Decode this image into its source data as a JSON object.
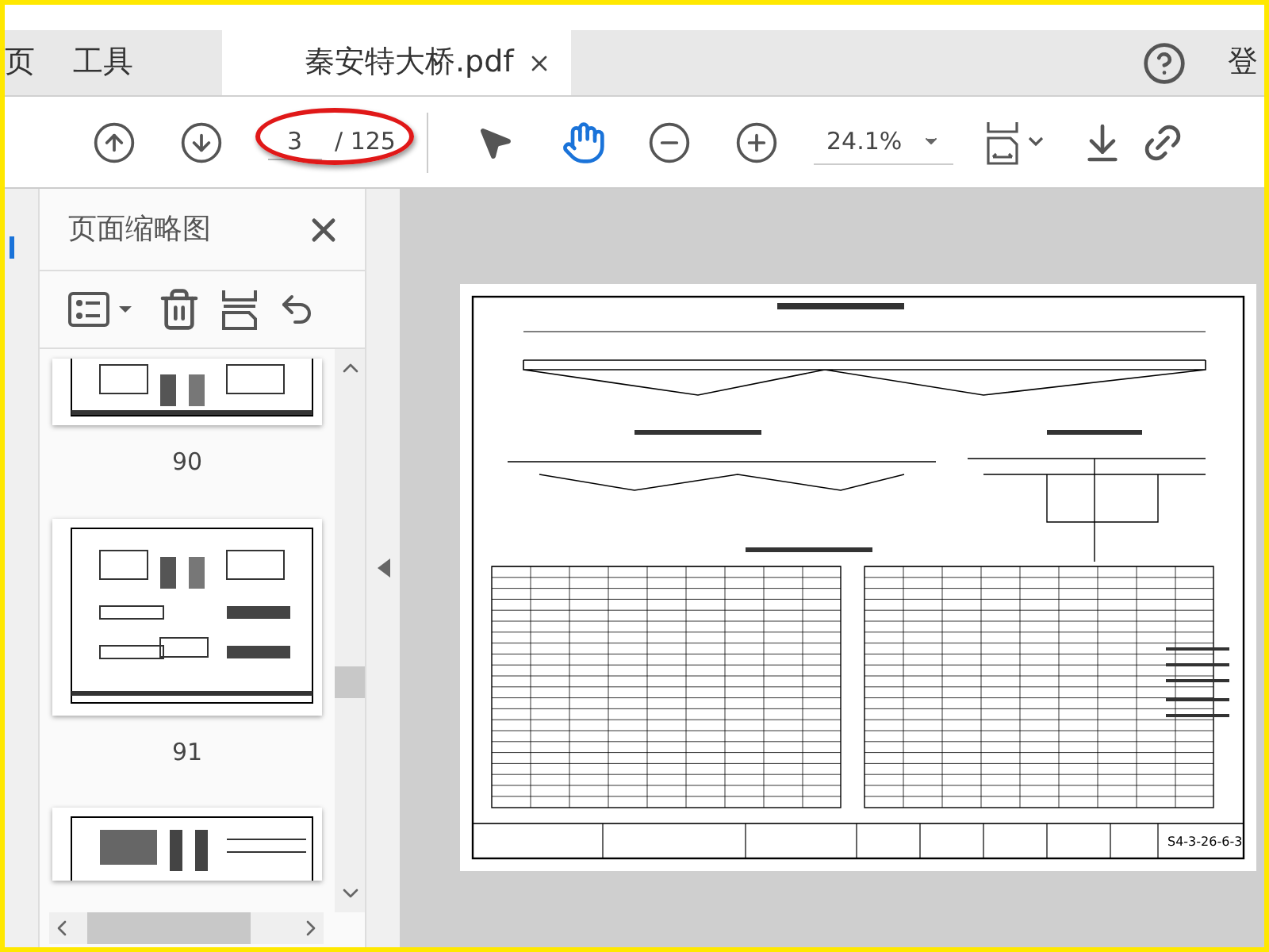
{
  "tabs": [
    {
      "label": "页",
      "selected": false
    },
    {
      "label": "工具",
      "selected": false
    },
    {
      "label": "秦安特大桥.pdf",
      "selected": true
    }
  ],
  "sign_in": "登",
  "toolbar": {
    "page_field": {
      "value": "3",
      "total": "/ 125",
      "highlighted": true
    },
    "tools": [
      {
        "kind": "pointer",
        "selected": false
      },
      {
        "kind": "hand",
        "selected": true
      }
    ],
    "zoom": "24.1%"
  },
  "thumbnail_panel": {
    "title": "页面缩略图",
    "thumbnails": [
      {
        "label": "90",
        "kind": "cut_top"
      },
      {
        "label": "91",
        "kind": "full"
      },
      {
        "kind": "cut_bottom"
      }
    ]
  },
  "document": {
    "drawing_number": "S4-3-26-6-3"
  }
}
